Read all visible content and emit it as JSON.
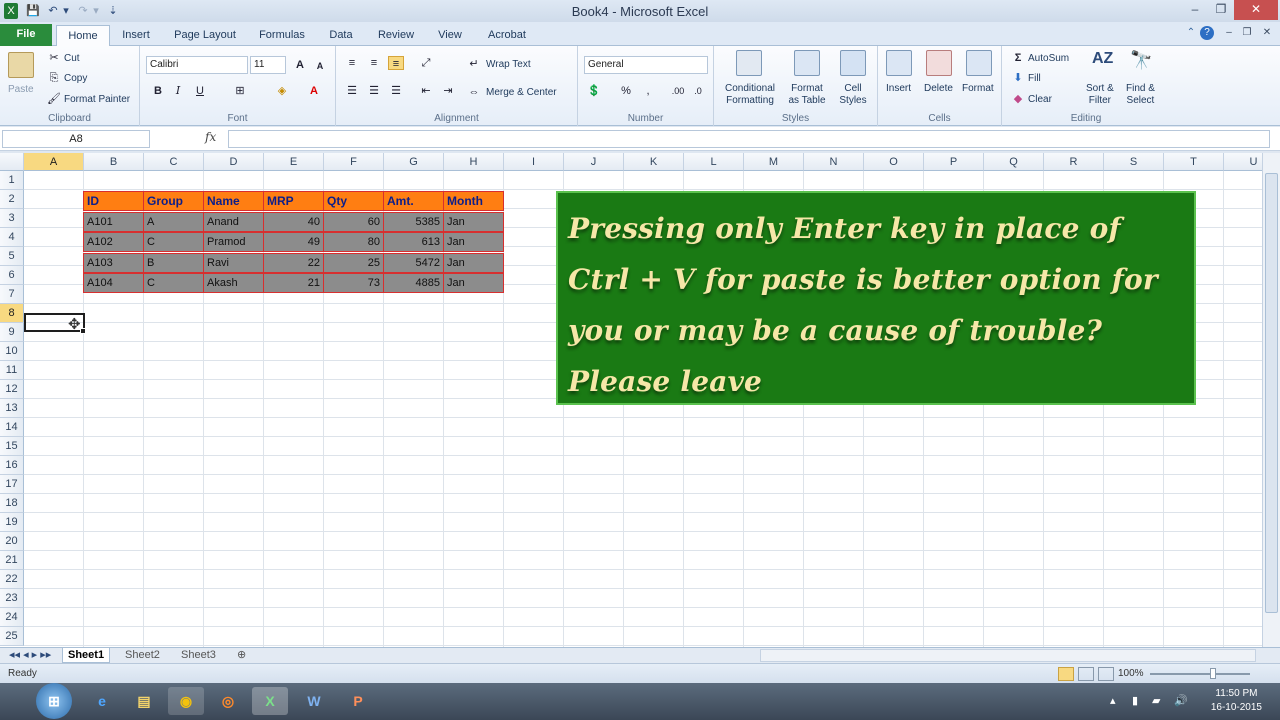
{
  "window": {
    "title": "Book4 - Microsoft Excel"
  },
  "ribbon_tabs": [
    "File",
    "Home",
    "Insert",
    "Page Layout",
    "Formulas",
    "Data",
    "Review",
    "View",
    "Acrobat"
  ],
  "clipboard": {
    "paste": "Paste",
    "cut": "Cut",
    "copy": "Copy",
    "format_painter": "Format Painter",
    "label": "Clipboard"
  },
  "font": {
    "name": "Calibri",
    "size": "11",
    "bold": "B",
    "italic": "I",
    "underline": "U",
    "label": "Font"
  },
  "alignment": {
    "wrap_text": "Wrap Text",
    "merge_center": "Merge & Center",
    "label": "Alignment"
  },
  "number": {
    "format": "General",
    "label": "Number"
  },
  "styles": {
    "conditional": [
      "Conditional",
      "Formatting"
    ],
    "format_table": [
      "Format",
      "as Table"
    ],
    "cell_styles": [
      "Cell",
      "Styles"
    ],
    "label": "Styles"
  },
  "cells": {
    "insert": "Insert",
    "delete": "Delete",
    "format": "Format",
    "label": "Cells"
  },
  "editing": {
    "autosum": "AutoSum",
    "fill": "Fill",
    "clear": "Clear",
    "sort_filter": [
      "Sort &",
      "Filter"
    ],
    "find_select": [
      "Find &",
      "Select"
    ],
    "label": "Editing"
  },
  "formula_bar": {
    "name_box": "A8",
    "fx": "fx",
    "content": ""
  },
  "columns": [
    "A",
    "B",
    "C",
    "D",
    "E",
    "F",
    "G",
    "H",
    "I",
    "J",
    "K",
    "L",
    "M",
    "N",
    "O",
    "P",
    "Q",
    "R",
    "S",
    "T",
    "U"
  ],
  "rows": [
    "1",
    "2",
    "3",
    "4",
    "5",
    "6",
    "7",
    "8",
    "9",
    "10",
    "11",
    "12",
    "13",
    "14",
    "15",
    "16",
    "17",
    "18",
    "19",
    "20",
    "21",
    "22",
    "23",
    "24",
    "25"
  ],
  "table": {
    "headers": [
      "ID",
      "Group",
      "Name",
      "MRP",
      "Qty",
      "Amt.",
      "Month"
    ],
    "rows": [
      [
        "A101",
        "A",
        "Anand",
        "40",
        "60",
        "5385",
        "Jan"
      ],
      [
        "A102",
        "C",
        "Pramod",
        "49",
        "80",
        "613",
        "Jan"
      ],
      [
        "A103",
        "B",
        "Ravi",
        "22",
        "25",
        "5472",
        "Jan"
      ],
      [
        "A104",
        "C",
        "Akash",
        "21",
        "73",
        "4885",
        "Jan"
      ]
    ]
  },
  "note": {
    "text": "Pressing only Enter key in place of Ctrl + V for paste is better option for you or may be a cause  of  trouble?  Please  leave"
  },
  "sheets": [
    "Sheet1",
    "Sheet2",
    "Sheet3"
  ],
  "status": {
    "ready": "Ready",
    "zoom": "100%"
  },
  "taskbar": {
    "time": "11:50 PM",
    "date": "16-10-2015"
  },
  "colors": {
    "header_fill": "#ff7e12",
    "header_text": "#0c1e8a",
    "data_fill": "#8c8c8c",
    "border": "#d72f2f",
    "note_bg": "#1a7a14",
    "note_text": "#f6e7a8"
  }
}
